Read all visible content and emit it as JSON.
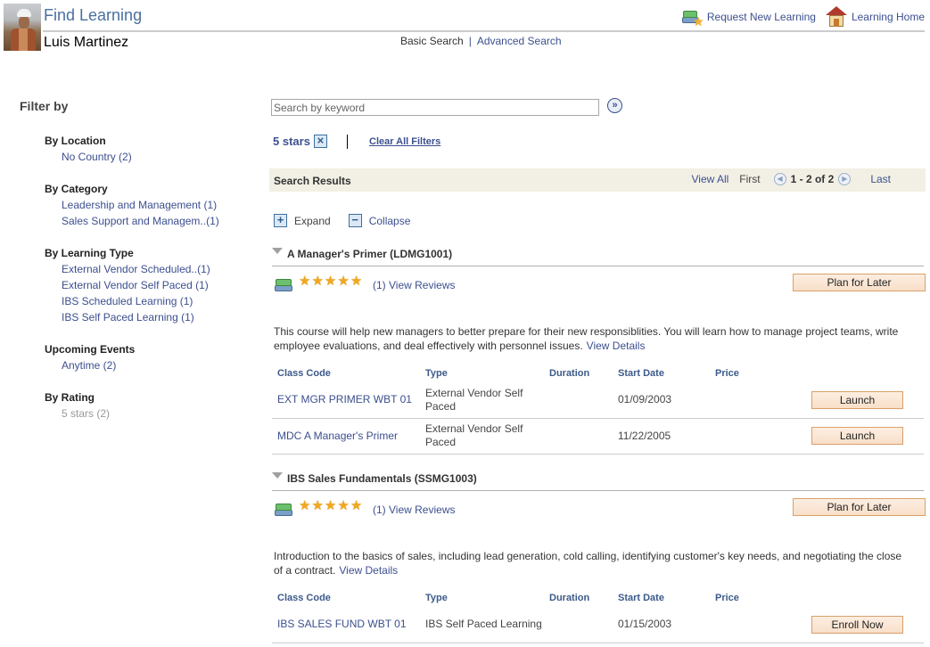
{
  "header": {
    "title": "Find Learning",
    "user_name": "Luis Martinez",
    "request_link": "Request New Learning",
    "home_link": "Learning Home",
    "search_nav": {
      "basic": "Basic Search",
      "separator": "|",
      "advanced": "Advanced Search"
    }
  },
  "filters": {
    "title": "Filter by",
    "groups": [
      {
        "title": "By Location",
        "items": [
          {
            "label": "No Country (2)"
          }
        ]
      },
      {
        "title": "By Category",
        "items": [
          {
            "label": "Leadership and Management (1)"
          },
          {
            "label": "Sales Support and Managem..(1)"
          }
        ]
      },
      {
        "title": "By Learning Type",
        "items": [
          {
            "label": "External Vendor Scheduled..(1)"
          },
          {
            "label": "External Vendor Self Paced (1)"
          },
          {
            "label": "IBS Scheduled Learning (1)"
          },
          {
            "label": "IBS Self Paced Learning (1)"
          }
        ]
      },
      {
        "title": "Upcoming Events",
        "items": [
          {
            "label": "Anytime (2)"
          }
        ]
      },
      {
        "title": "By Rating",
        "items": [
          {
            "label": "5 stars (2)",
            "disabled": true
          }
        ]
      }
    ]
  },
  "search": {
    "placeholder": "Search by keyword",
    "value": "",
    "go_icon": "double-chevron-right-icon",
    "active_filter": "5 stars",
    "remove_icon": "x",
    "clear_all": "Clear All Filters"
  },
  "results": {
    "title": "Search Results",
    "view_all": "View All",
    "first": "First",
    "count": "1 - 2 of 2",
    "last": "Last",
    "prev_icon": "◀",
    "next_icon": "▶",
    "expand": "Expand",
    "collapse": "Collapse",
    "expand_icon": "+",
    "collapse_icon": "−"
  },
  "columns": {
    "class_code": "Class Code",
    "type": "Type",
    "duration": "Duration",
    "start_date": "Start Date",
    "price": "Price"
  },
  "courses": [
    {
      "title": "A Manager's Primer (LDMG1001)",
      "rating": 5,
      "review_count": "(1)",
      "view_reviews": "View Reviews",
      "plan_button": "Plan for Later",
      "description": "This course will help new managers to better prepare for their new responsiblities. You will learn how to manage project teams, write employee evaluations, and deal effectively with personnel issues.",
      "view_details": "View Details",
      "classes": [
        {
          "code": "EXT MGR PRIMER WBT 01",
          "type": "External Vendor Self Paced",
          "duration": "",
          "start_date": "01/09/2003",
          "price": "",
          "action": "Launch"
        },
        {
          "code": "MDC A Manager's Primer",
          "type": "External Vendor Self Paced",
          "duration": "",
          "start_date": "11/22/2005",
          "price": "",
          "action": "Launch"
        }
      ]
    },
    {
      "title": "IBS Sales Fundamentals (SSMG1003)",
      "rating": 5,
      "review_count": "(1)",
      "view_reviews": "View Reviews",
      "plan_button": "Plan for Later",
      "description": "Introduction to the basics of sales, including lead generation, cold calling, identifying customer's key needs, and negotiating the close of a contract.",
      "view_details": "View Details",
      "classes": [
        {
          "code": "IBS SALES FUND WBT 01",
          "type": "IBS Self Paced Learning",
          "duration": "",
          "start_date": "01/15/2003",
          "price": "",
          "action": "Enroll Now"
        }
      ]
    }
  ],
  "colors": {
    "link": "#3c4f8f",
    "title": "#4a6fa0",
    "results_bar": "#f2f0e4",
    "button_bg": "#fbe6d4",
    "button_border": "#d9a06a",
    "star": "#f0a820"
  }
}
